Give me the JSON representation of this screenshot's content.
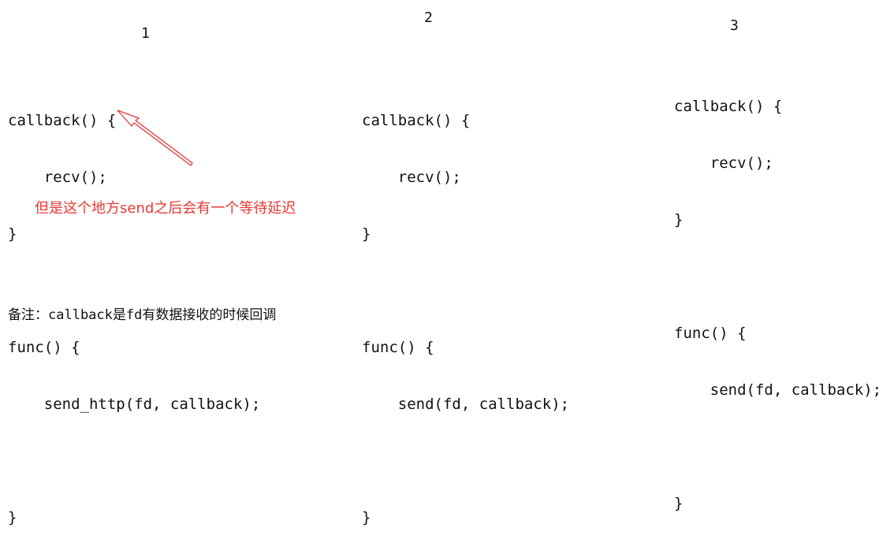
{
  "columns": [
    {
      "label": "1",
      "lines": [
        "callback() {",
        "    recv();",
        "}",
        "",
        "func() {",
        "    send_http(fd, callback);",
        "",
        "}"
      ]
    },
    {
      "label": "2",
      "lines": [
        "callback() {",
        "    recv();",
        "}",
        "",
        "func() {",
        "    send(fd, callback);",
        "",
        "}"
      ]
    },
    {
      "label": "3",
      "lines": [
        "callback() {",
        "    recv();",
        "}",
        "",
        "func() {",
        "    send(fd, callback);",
        "",
        "}"
      ]
    }
  ],
  "annotation": {
    "text": "但是这个地方send之后会有一个等待延迟",
    "color": "#e53935"
  },
  "footnote": "备注：callback是fd有数据接收的时候回调"
}
